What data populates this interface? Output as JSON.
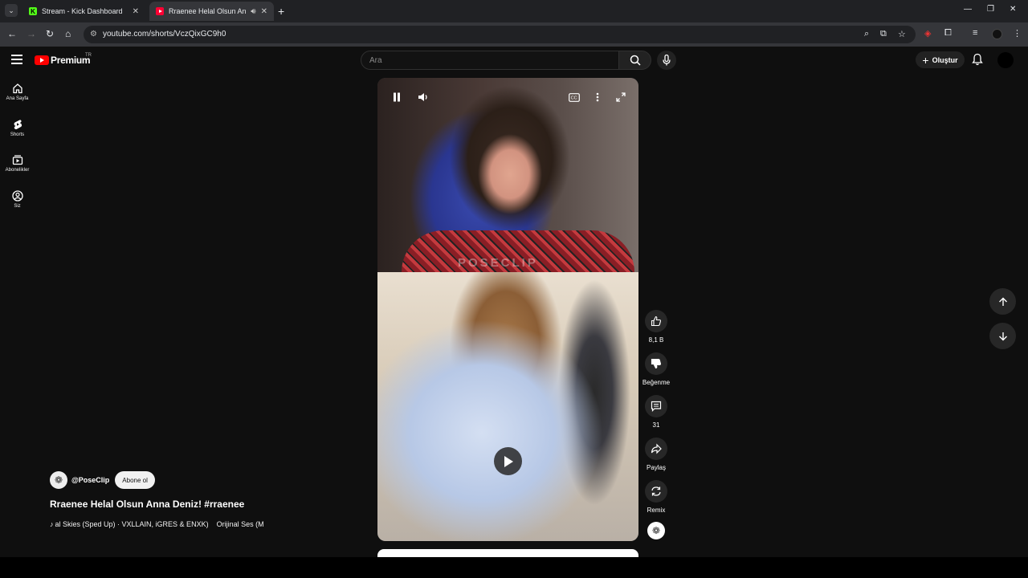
{
  "browser": {
    "tabs": [
      {
        "title": "Stream - Kick Dashboard",
        "favicon": "kick-icon",
        "favicon_text": "K"
      },
      {
        "title": "Rraenee Helal Olsun Anna D",
        "favicon": "youtube-icon",
        "active": true
      }
    ],
    "url": "youtube.com/shorts/VczQixGC9h0",
    "accent_colors": {
      "tab_bg": "#202124",
      "toolbar_bg": "#35363a",
      "kick_green": "#53fc18"
    }
  },
  "youtube": {
    "logo_text": "Premium",
    "country_code": "TR",
    "search_placeholder": "Ara",
    "create_label": "Oluştur",
    "sidebar": [
      {
        "label": "Ana Sayfa",
        "icon": "home-icon"
      },
      {
        "label": "Shorts",
        "icon": "shorts-icon"
      },
      {
        "label": "Abonelikler",
        "icon": "subscriptions-icon"
      },
      {
        "label": "Siz",
        "icon": "user-icon"
      }
    ],
    "video": {
      "watermark": "POSECLIP",
      "state": "paused"
    },
    "actions": {
      "like_count": "8,1 B",
      "dislike_label": "Beğenme",
      "comment_count": "31",
      "share_label": "Paylaş",
      "remix_label": "Remix"
    },
    "meta": {
      "channel": "@PoseClip",
      "subscribe_label": "Abone ol",
      "title": "Rraenee Helal Olsun Anna Deniz!  #rraenee",
      "music": "al Skies (Sped Up) · VXLLAIN, iGRES & ENXK)",
      "original_sound": "Orijinal Ses (M"
    }
  }
}
